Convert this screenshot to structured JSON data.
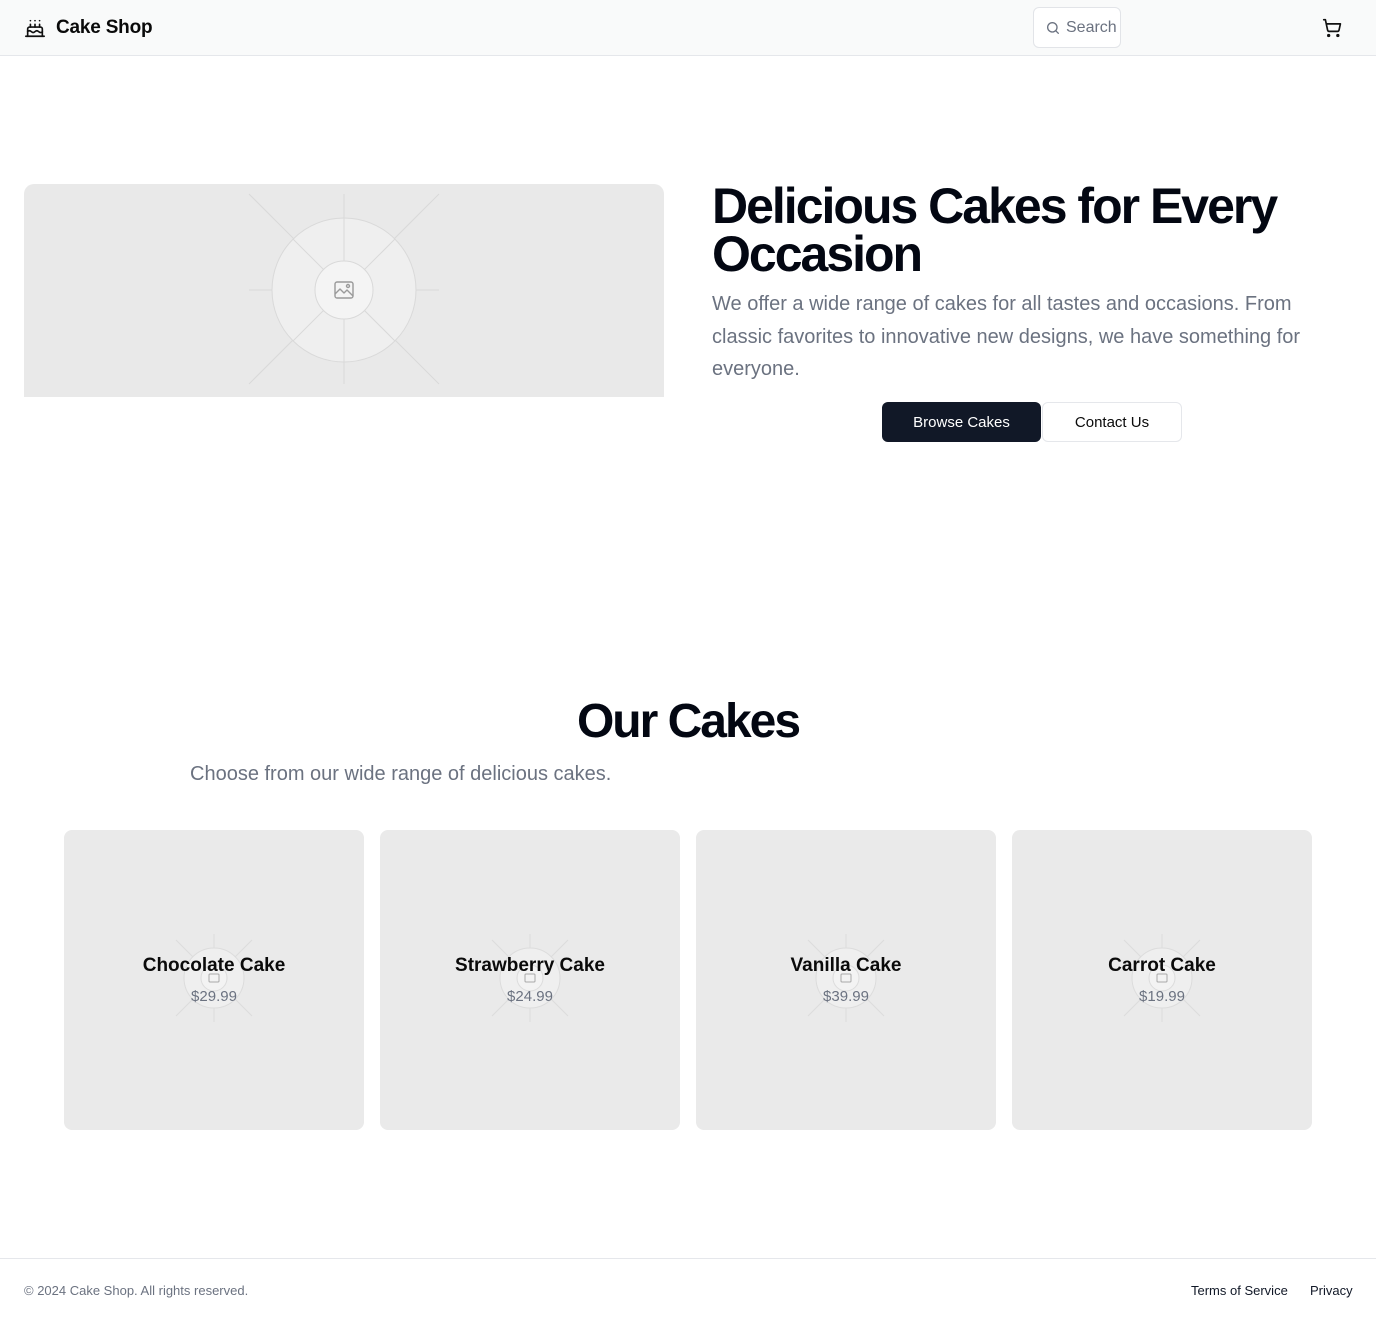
{
  "header": {
    "brand": "Cake Shop",
    "brand_icon": "cake-icon",
    "search_placeholder": "Search",
    "search_icon": "search-icon",
    "cart_icon": "shopping-cart-icon"
  },
  "hero": {
    "image_icon": "image-placeholder-icon",
    "title": "Delicious Cakes for Every Occasion",
    "description": "We offer a wide range of cakes for all tastes and occasions. From classic favorites to innovative new designs, we have something for everyone.",
    "primary_button": "Browse Cakes",
    "secondary_button": "Contact Us"
  },
  "cakes_section": {
    "title": "Our Cakes",
    "subtitle": "Choose from our wide range of delicious cakes.",
    "items": [
      {
        "name": "Chocolate Cake",
        "price": "$29.99"
      },
      {
        "name": "Strawberry Cake",
        "price": "$24.99"
      },
      {
        "name": "Vanilla Cake",
        "price": "$39.99"
      },
      {
        "name": "Carrot Cake",
        "price": "$19.99"
      }
    ]
  },
  "footer": {
    "copyright": "© 2024 Cake Shop. All rights reserved.",
    "links": [
      "Terms of Service",
      "Privacy"
    ]
  },
  "colors": {
    "primary_button_bg": "#111827",
    "placeholder_bg": "#e9e9e9",
    "muted_text": "#6b7280"
  }
}
